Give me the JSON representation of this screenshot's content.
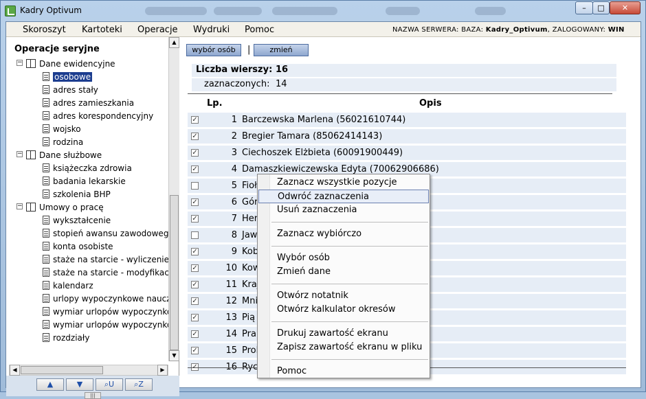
{
  "window": {
    "title": "Kadry Optivum",
    "buttons": {
      "minimize": "–",
      "maximize": "□",
      "close": "✕"
    }
  },
  "menubar": {
    "items": [
      "Skoroszyt",
      "Kartoteki",
      "Operacje",
      "Wydruki",
      "Pomoc"
    ],
    "server_label": "NAZWA SERWERA:",
    "db_label": "BAZA:",
    "db_value": "Kadry_Optivum",
    "user_label": ", ZALOGOWANY:",
    "user_value": "WIN"
  },
  "tree": {
    "title": "Operacje seryjne",
    "groups": [
      {
        "label": "Dane ewidencyjne",
        "items": [
          "osobowe",
          "adres stały",
          "adres zamieszkania",
          "adres korespondencyjny",
          "wojsko",
          "rodzina"
        ]
      },
      {
        "label": "Dane służbowe",
        "items": [
          "książeczka zdrowia",
          "badania lekarskie",
          "szkolenia BHP"
        ]
      },
      {
        "label": "Umowy o pracę",
        "items": [
          "wykształcenie",
          "stopień awansu zawodowego",
          "konta osobiste",
          "staże na starcie - wyliczenie",
          "staże na starcie - modyfikacja",
          "kalendarz",
          "urlopy wypoczynkowe nauczycieli",
          "wymiar urlopów wypoczynkowych",
          "wymiar urlopów wypoczynkowych",
          "rozdziały"
        ]
      }
    ],
    "selected": "osobowe"
  },
  "nav_buttons": {
    "up": "▲",
    "down": "▼",
    "find_u": "U",
    "find_z": "Z"
  },
  "toolbar": {
    "select_people": "wybór osób",
    "separator": "|",
    "change": "zmień"
  },
  "stats": {
    "rows_label": "Liczba wierszy:",
    "rows_value": "16",
    "checked_label": "zaznaczonych:",
    "checked_value": "14"
  },
  "table": {
    "headers": {
      "lp": "Lp.",
      "opis": "Opis"
    },
    "rows": [
      {
        "lp": "1",
        "opis": "Barczewska Marlena (56021610744)",
        "checked": true
      },
      {
        "lp": "2",
        "opis": "Bregier Tamara (85062414143)",
        "checked": true
      },
      {
        "lp": "3",
        "opis": "Ciechoszek Elżbieta (60091900449)",
        "checked": true
      },
      {
        "lp": "4",
        "opis": "Damaszkiewiczewska Edyta (70062906686)",
        "checked": true
      },
      {
        "lp": "5",
        "opis": "Fioł",
        "checked": false
      },
      {
        "lp": "6",
        "opis": "Gór",
        "checked": true
      },
      {
        "lp": "7",
        "opis": "Her",
        "checked": true
      },
      {
        "lp": "8",
        "opis": "Jaw",
        "checked": false
      },
      {
        "lp": "9",
        "opis": "Kob",
        "checked": true
      },
      {
        "lp": "10",
        "opis": "Kow",
        "checked": true
      },
      {
        "lp": "11",
        "opis": "Kraj",
        "checked": true
      },
      {
        "lp": "12",
        "opis": "Mni",
        "checked": true
      },
      {
        "lp": "13",
        "opis": "Pią",
        "checked": true
      },
      {
        "lp": "14",
        "opis": "Pral",
        "checked": true
      },
      {
        "lp": "15",
        "opis": "Prol",
        "checked": true
      },
      {
        "lp": "16",
        "opis": "Ryc",
        "checked": true
      }
    ]
  },
  "context_menu": {
    "groups": [
      [
        "Zaznacz wszystkie pozycje",
        "Odwróć zaznaczenia",
        "Usuń zaznaczenia"
      ],
      [
        "Zaznacz wybiórczo"
      ],
      [
        "Wybór osób",
        "Zmień dane"
      ],
      [
        "Otwórz notatnik",
        "Otwórz kalkulator okresów"
      ],
      [
        "Drukuj zawartość ekranu",
        "Zapisz zawartość ekranu w pliku"
      ],
      [
        "Pomoc"
      ]
    ],
    "highlighted": "Odwróć zaznaczenia"
  },
  "colors": {
    "selection": "#1c3d8f",
    "row_bg": "#e6edf6",
    "button_bg": "#8ea7cf"
  }
}
